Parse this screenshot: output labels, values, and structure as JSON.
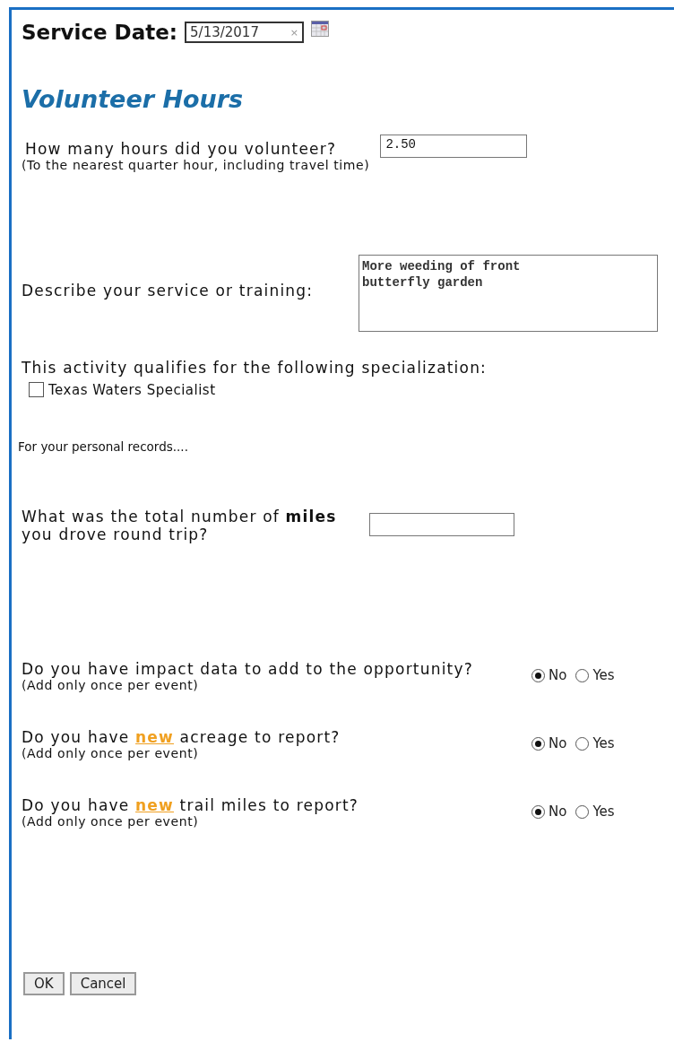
{
  "service_date": {
    "label": "Service Date:",
    "value": "5/13/2017",
    "clear": "×"
  },
  "section_title": "Volunteer Hours",
  "hours": {
    "question": "How many hours did you volunteer?",
    "note": "(To the nearest quarter hour, including travel time)",
    "value": "2.50"
  },
  "description": {
    "label": "Describe your service or training:",
    "value": "More weeding of front\nbutterfly garden"
  },
  "specialization": {
    "label": "This activity qualifies for the following specialization:",
    "options": [
      {
        "label": "Texas Waters Specialist",
        "checked": false
      }
    ]
  },
  "personal_note": "For your personal records....",
  "miles": {
    "question": "What was the total number of **miles** you drove round trip?"
  },
  "questions": [
    {
      "question": "Do you have impact data to add to the opportunity?",
      "note": "(Add only once per event)",
      "options": [
        {
          "label": "No",
          "selected": true
        },
        {
          "label": "Yes",
          "selected": false
        }
      ]
    },
    {
      "question": "Do you have **new** acreage to report?",
      "note": "(Add only once per event)",
      "options": [
        {
          "label": "No",
          "selected": true
        },
        {
          "label": "Yes",
          "selected": false
        }
      ]
    },
    {
      "question": "Do you have **new** trail miles to report?",
      "note": "(Add only once per event)",
      "options": [
        {
          "label": "No",
          "selected": true
        },
        {
          "label": "Yes",
          "selected": false
        }
      ]
    }
  ],
  "buttons": [
    "OK",
    "Cancel"
  ]
}
